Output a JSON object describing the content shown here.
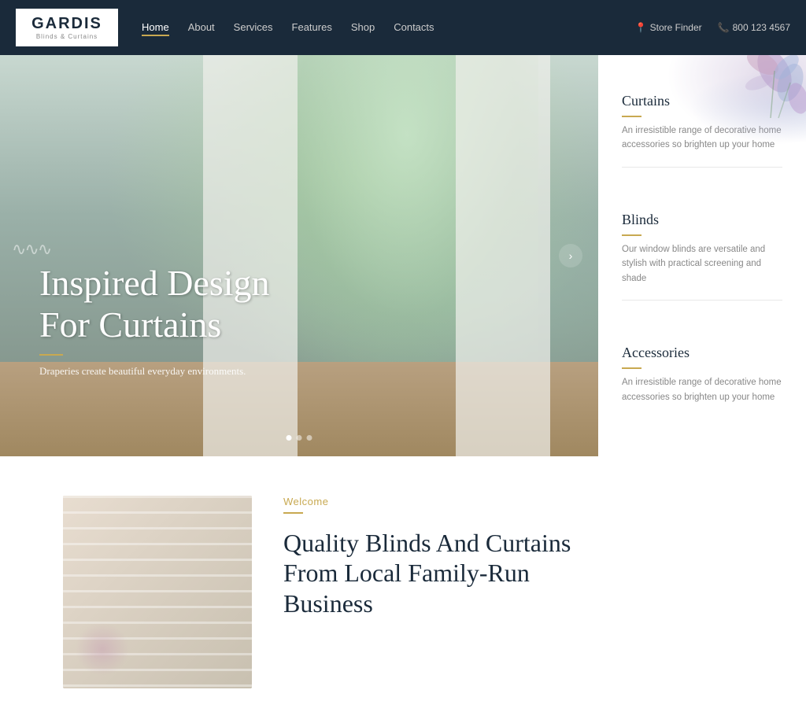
{
  "brand": {
    "name": "GARDIS",
    "subtitle": "Blinds & Curtains"
  },
  "nav": {
    "links": [
      {
        "label": "Home",
        "active": true
      },
      {
        "label": "About",
        "active": false
      },
      {
        "label": "Services",
        "active": false
      },
      {
        "label": "Features",
        "active": false
      },
      {
        "label": "Shop",
        "active": false
      },
      {
        "label": "Contacts",
        "active": false
      }
    ],
    "store_finder": "Store Finder",
    "phone": "800 123 4567"
  },
  "hero": {
    "title_line1": "Inspired Design",
    "title_line2": "For Curtains",
    "subtitle": "Draperies create beautiful everyday environments.",
    "arrow_label": "›"
  },
  "side_panel": {
    "items": [
      {
        "title": "Curtains",
        "description": "An irresistible range of decorative home accessories so brighten up your home"
      },
      {
        "title": "Blinds",
        "description": "Our window blinds are versatile and stylish with practical screening and shade"
      },
      {
        "title": "Accessories",
        "description": "An irresistible range of decorative home accessories so brighten up your home"
      }
    ]
  },
  "bottom": {
    "welcome_label": "Welcome",
    "title_line1": "Quality Blinds And Curtains",
    "title_line2": "From Local Family-Run",
    "title_line3": "Business"
  }
}
